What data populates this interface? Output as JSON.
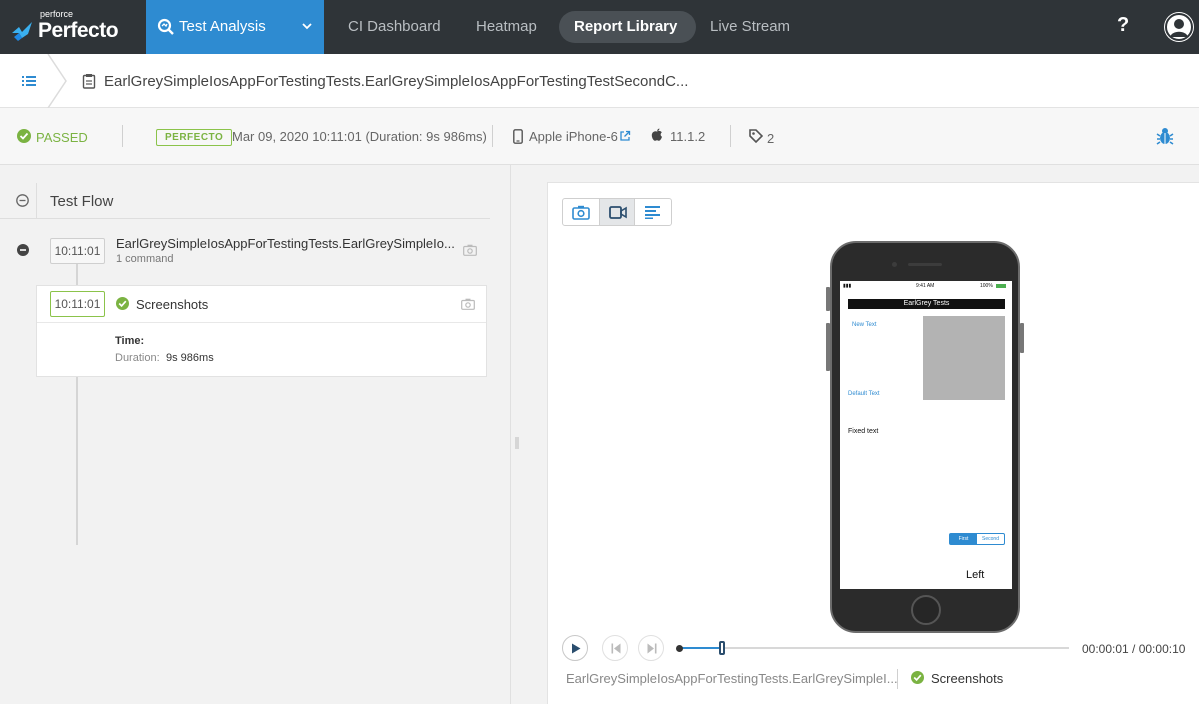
{
  "brand": {
    "small": "perforce",
    "name": "Perfecto"
  },
  "nav": {
    "active": "Test Analysis",
    "items": [
      "CI Dashboard",
      "Heatmap",
      "Report Library",
      "Live Stream"
    ],
    "help": "?"
  },
  "breadcrumb": {
    "title": "EarlGreySimpleIosAppForTestingTests.EarlGreySimpleIosAppForTestingTestSecondC..."
  },
  "status": {
    "result": "PASSED",
    "badge": "PERFECTO",
    "datetime": "Mar 09, 2020 10:11:01 (Duration: 9s 986ms)",
    "device": "Apple iPhone-6",
    "os_version": "11.1.2",
    "tags_count": "2"
  },
  "test_flow": {
    "title": "Test Flow",
    "group": {
      "time": "10:11:01",
      "name": "EarlGreySimpleIosAppForTestingTests.EarlGreySimpleIo...",
      "sub": "1 command"
    },
    "command": {
      "time": "10:11:01",
      "name": "Screenshots",
      "time_label": "Time:",
      "duration_label": "Duration:",
      "duration": "9s 986ms"
    }
  },
  "device_screen": {
    "status_time": "9:41 AM",
    "battery": "100%",
    "nav_title": "EarlGrey Tests",
    "new_text": "New Text",
    "default_text": "Default Text",
    "fixed_text": "Fixed text",
    "segment_first": "First",
    "segment_second": "Second",
    "left_label": "Left"
  },
  "player": {
    "progress": 0.11,
    "time": "00:00:01 / 00:00:10",
    "test_name": "EarlGreySimpleIosAppForTestingTests.EarlGreySimpleI...",
    "step": "Screenshots"
  },
  "colors": {
    "accent": "#2e8bd1",
    "nav_bg": "#2f3438",
    "passed": "#7bb342"
  }
}
